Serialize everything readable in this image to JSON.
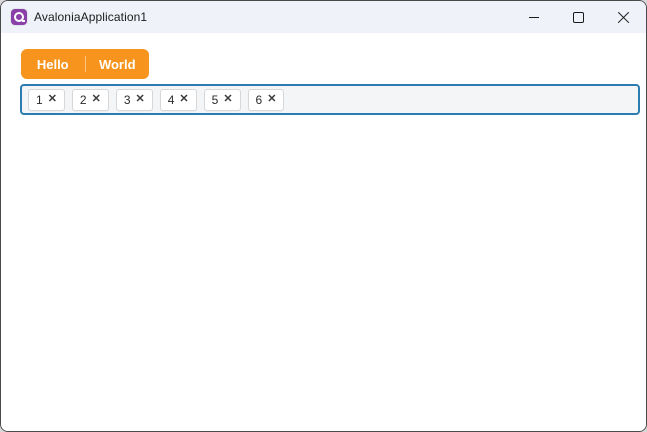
{
  "window": {
    "title": "AvaloniaApplication1",
    "app_icon": "avalonia-logo-icon",
    "controls": [
      {
        "name": "minimize",
        "icon": "minimize-icon"
      },
      {
        "name": "maximize",
        "icon": "maximize-icon"
      },
      {
        "name": "close",
        "icon": "close-icon"
      }
    ]
  },
  "tabs": [
    {
      "label": "Hello",
      "selected": true
    },
    {
      "label": "World",
      "selected": false
    }
  ],
  "chipbar": {
    "chips": [
      "1",
      "2",
      "3",
      "4",
      "5",
      "6"
    ],
    "remove_glyph": "✕"
  },
  "colors": {
    "accent_orange": "#F7941E",
    "focus_border_blue": "#2B7CB1",
    "titlebar_bg": "#EFF3F9",
    "avalonia_purple": "#8B3FA8",
    "chip_bg": "#FFFFFF",
    "chipbar_bg": "#F3F5F7"
  }
}
